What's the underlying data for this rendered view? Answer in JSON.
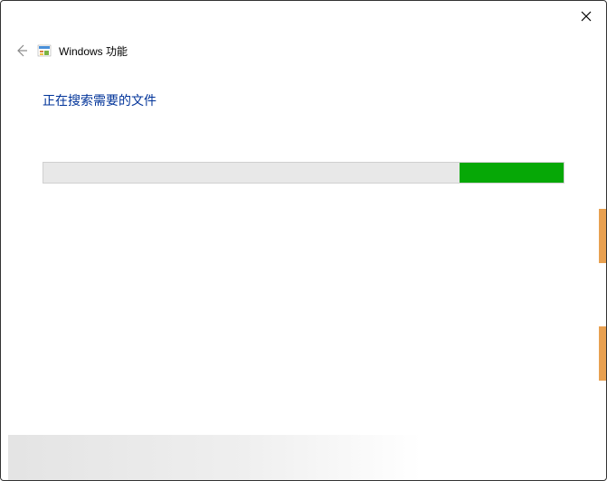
{
  "titlebar": {
    "close_label": "✕"
  },
  "header": {
    "back_arrow": "←",
    "window_title": "Windows 功能"
  },
  "content": {
    "status_text": "正在搜索需要的文件",
    "progress_percent": 20
  },
  "colors": {
    "progress_green": "#06a806",
    "progress_bg": "#e8e8e8",
    "status_blue": "#003399"
  }
}
